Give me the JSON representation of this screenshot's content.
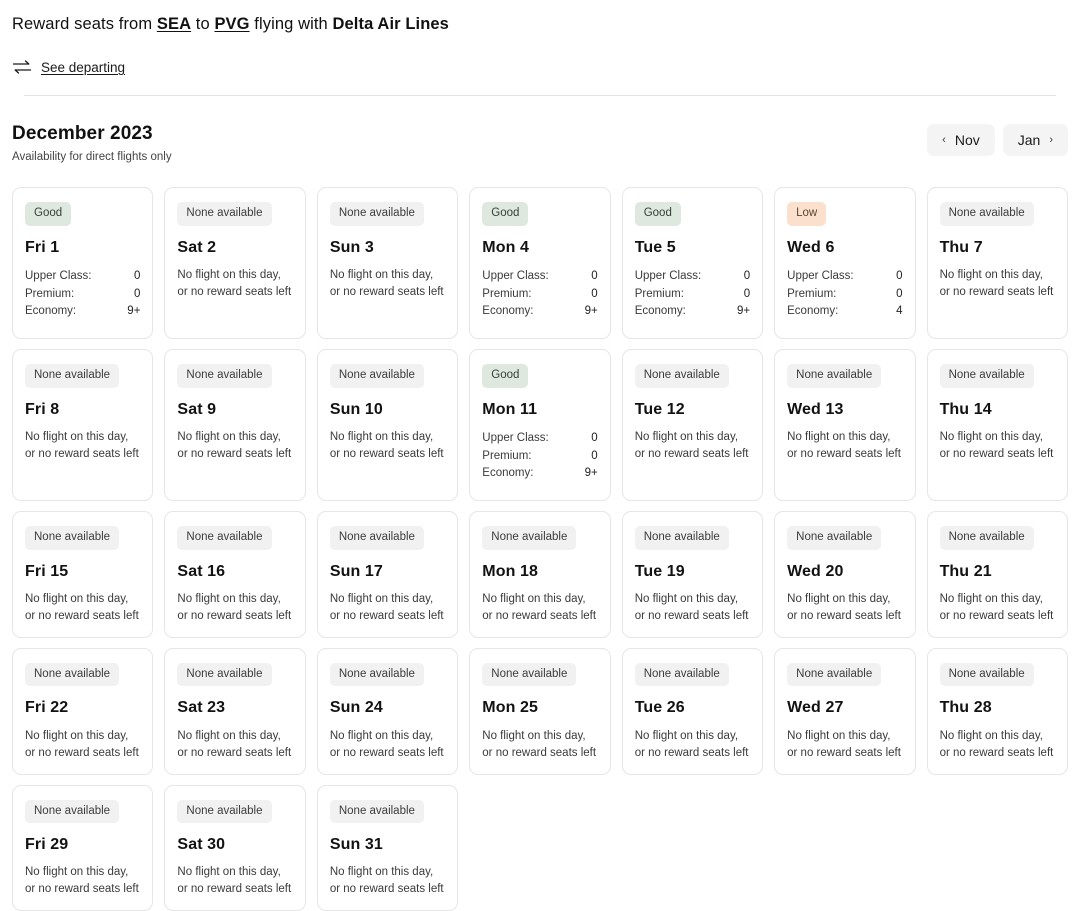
{
  "header": {
    "title_prefix": "Reward seats from ",
    "origin": "SEA",
    "title_mid": " to ",
    "destination": "PVG",
    "title_mid2": " flying with ",
    "airline": "Delta Air Lines",
    "see_departing_label": "See departing",
    "swap_icon": "swap-arrows-icon"
  },
  "month": {
    "title": "December 2023",
    "subtitle": "Availability for direct flights only",
    "prev_label": "Nov",
    "prev_chevron": "‹",
    "next_label": "Jan",
    "next_chevron": "›"
  },
  "labels": {
    "no_flight_line1": "No flight on this day,",
    "no_flight_line2": "or no reward seats left",
    "cabin_upper": "Upper Class:",
    "cabin_premium": "Premium:",
    "cabin_economy": "Economy:"
  },
  "colors": {
    "good_bg": "#dfe8df",
    "low_bg": "#fbe0cd",
    "none_bg": "#f1f1f1",
    "card_border": "#e6e6e6",
    "nav_bg": "#f4f4f4"
  },
  "days": [
    {
      "day": "Fri 1",
      "status": "Good",
      "status_kind": "good",
      "tall": true,
      "seats": {
        "upper": "0",
        "premium": "0",
        "economy": "9+"
      }
    },
    {
      "day": "Sat 2",
      "status": "None available",
      "status_kind": "none",
      "tall": true,
      "seats": null
    },
    {
      "day": "Sun 3",
      "status": "None available",
      "status_kind": "none",
      "tall": true,
      "seats": null
    },
    {
      "day": "Mon 4",
      "status": "Good",
      "status_kind": "good",
      "tall": true,
      "seats": {
        "upper": "0",
        "premium": "0",
        "economy": "9+"
      }
    },
    {
      "day": "Tue 5",
      "status": "Good",
      "status_kind": "good",
      "tall": true,
      "seats": {
        "upper": "0",
        "premium": "0",
        "economy": "9+"
      }
    },
    {
      "day": "Wed 6",
      "status": "Low",
      "status_kind": "low",
      "tall": true,
      "seats": {
        "upper": "0",
        "premium": "0",
        "economy": "4"
      }
    },
    {
      "day": "Thu 7",
      "status": "None available",
      "status_kind": "none",
      "tall": true,
      "seats": null
    },
    {
      "day": "Fri 8",
      "status": "None available",
      "status_kind": "none",
      "tall": true,
      "seats": null
    },
    {
      "day": "Sat 9",
      "status": "None available",
      "status_kind": "none",
      "tall": true,
      "seats": null
    },
    {
      "day": "Sun 10",
      "status": "None available",
      "status_kind": "none",
      "tall": true,
      "seats": null
    },
    {
      "day": "Mon 11",
      "status": "Good",
      "status_kind": "good",
      "tall": true,
      "seats": {
        "upper": "0",
        "premium": "0",
        "economy": "9+"
      }
    },
    {
      "day": "Tue 12",
      "status": "None available",
      "status_kind": "none",
      "tall": true,
      "seats": null
    },
    {
      "day": "Wed 13",
      "status": "None available",
      "status_kind": "none",
      "tall": true,
      "seats": null
    },
    {
      "day": "Thu 14",
      "status": "None available",
      "status_kind": "none",
      "tall": true,
      "seats": null
    },
    {
      "day": "Fri 15",
      "status": "None available",
      "status_kind": "none",
      "tall": false,
      "seats": null
    },
    {
      "day": "Sat 16",
      "status": "None available",
      "status_kind": "none",
      "tall": false,
      "seats": null
    },
    {
      "day": "Sun 17",
      "status": "None available",
      "status_kind": "none",
      "tall": false,
      "seats": null
    },
    {
      "day": "Mon 18",
      "status": "None available",
      "status_kind": "none",
      "tall": false,
      "seats": null
    },
    {
      "day": "Tue 19",
      "status": "None available",
      "status_kind": "none",
      "tall": false,
      "seats": null
    },
    {
      "day": "Wed 20",
      "status": "None available",
      "status_kind": "none",
      "tall": false,
      "seats": null
    },
    {
      "day": "Thu 21",
      "status": "None available",
      "status_kind": "none",
      "tall": false,
      "seats": null
    },
    {
      "day": "Fri 22",
      "status": "None available",
      "status_kind": "none",
      "tall": false,
      "seats": null
    },
    {
      "day": "Sat 23",
      "status": "None available",
      "status_kind": "none",
      "tall": false,
      "seats": null
    },
    {
      "day": "Sun 24",
      "status": "None available",
      "status_kind": "none",
      "tall": false,
      "seats": null
    },
    {
      "day": "Mon 25",
      "status": "None available",
      "status_kind": "none",
      "tall": false,
      "seats": null
    },
    {
      "day": "Tue 26",
      "status": "None available",
      "status_kind": "none",
      "tall": false,
      "seats": null
    },
    {
      "day": "Wed 27",
      "status": "None available",
      "status_kind": "none",
      "tall": false,
      "seats": null
    },
    {
      "day": "Thu 28",
      "status": "None available",
      "status_kind": "none",
      "tall": false,
      "seats": null
    },
    {
      "day": "Fri 29",
      "status": "None available",
      "status_kind": "none",
      "tall": false,
      "seats": null
    },
    {
      "day": "Sat 30",
      "status": "None available",
      "status_kind": "none",
      "tall": false,
      "seats": null
    },
    {
      "day": "Sun 31",
      "status": "None available",
      "status_kind": "none",
      "tall": false,
      "seats": null
    }
  ]
}
